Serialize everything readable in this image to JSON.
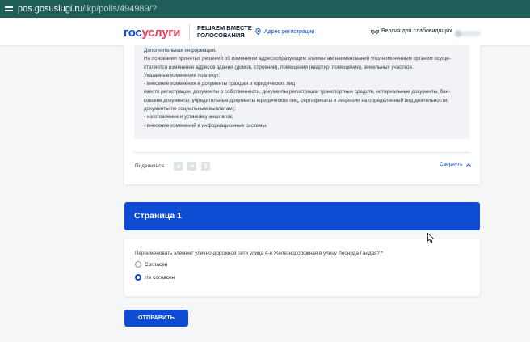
{
  "browser": {
    "url_host": "pos.gosuslugi.ru",
    "url_path": "/lkp/polls/494989/?"
  },
  "header": {
    "logo_part1": "гос",
    "logo_part2": "услуги",
    "slogan_line1": "РЕШАЕМ ВМЕСТЕ",
    "slogan_line2": "ГОЛОСОВАНИЯ",
    "address_link": "Адрес регистрации",
    "vision_link": "Версия для слабовидящих"
  },
  "info": {
    "lines": [
      "Дополнительная информация.",
      "На основании принятых решений об изменении адресообразующим элементам наименований уполномоченным органом осуще-",
      "ствляется изменение адресов зданий (домов, строений), помещений (квартир, помещений), земельных участков.",
      "Указанные изменения повлекут:",
      "- внесение изменения в документы граждан и юридических лиц",
      "(место регистрации, документы о собственности, документы регистрации транспортных средств, нотариальные документы, бан-",
      "ковские документы, учредительные документы юридических лиц, сертификаты и лицензии на определенный вид деятельности,",
      "документы по социальным выплатам);",
      "- изготовление и установку аншлагов;",
      "- внесение изменений в информационные системы."
    ],
    "share_label": "Поделиться",
    "share_buttons": [
      "telegram-icon",
      "vk-icon",
      "odnoklassniki-icon"
    ],
    "collapse_label": "Свернуть"
  },
  "page": {
    "title": "Страница 1"
  },
  "question": {
    "text": "Переименовать элемент улично-дорожной сети улица 4-я Железнодорожная в улицу Леонида Гайдая? *",
    "options": [
      {
        "label": "Согласен",
        "selected": false
      },
      {
        "label": "Не согласен",
        "selected": true
      }
    ]
  },
  "submit_label": "ОТПРАВИТЬ",
  "colors": {
    "brand_blue": "#0d4cd3",
    "brand_red": "#ee3f58",
    "browser_bar": "#1f5e58"
  }
}
